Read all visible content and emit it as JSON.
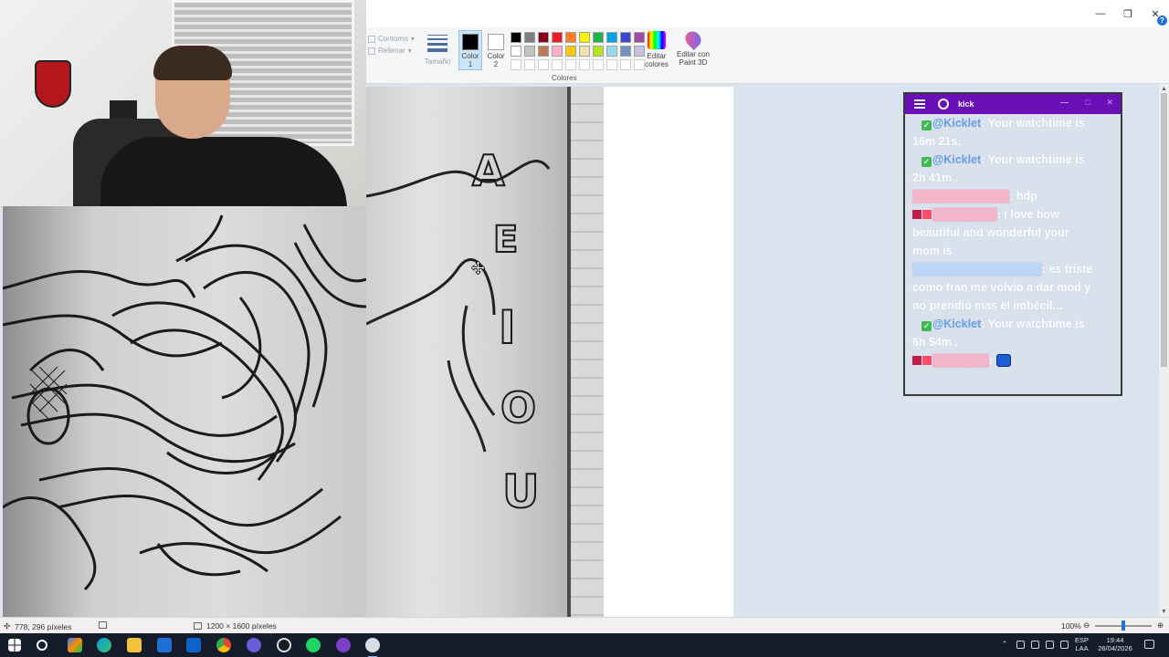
{
  "app": {
    "window_controls": {
      "minimize": "—",
      "restore": "❐",
      "close": "✕",
      "help": "?"
    }
  },
  "ribbon": {
    "outline_label": "Contorno",
    "fill_label": "Rellenar",
    "size_label": "Tamaño",
    "color1_label": [
      "Color",
      "1"
    ],
    "color2_label": [
      "Color",
      "2"
    ],
    "edit_colors_label": [
      "Editar",
      "colores"
    ],
    "edit_paint3d_label": [
      "Editar con",
      "Paint 3D"
    ],
    "colors_group_label": "Colores",
    "color1_value": "#000000",
    "color2_value": "#ffffff",
    "palette_row1": [
      "#000000",
      "#7f7f7f",
      "#880015",
      "#ed1c24",
      "#ff7f27",
      "#fff200",
      "#22b14c",
      "#00a2e8",
      "#3f48cc",
      "#a349a4"
    ],
    "palette_row2": [
      "#ffffff",
      "#c3c3c3",
      "#b97a57",
      "#ffaec9",
      "#ffc90e",
      "#efe4b0",
      "#b5e61d",
      "#99d9ea",
      "#7092be",
      "#c8bfe7"
    ],
    "palette_row3": [
      "#ffffff",
      "#ffffff",
      "#ffffff",
      "#ffffff",
      "#ffffff",
      "#ffffff",
      "#ffffff",
      "#ffffff",
      "#ffffff",
      "#ffffff"
    ]
  },
  "maze": {
    "letters": [
      "A",
      "E",
      "I",
      "O",
      "U"
    ]
  },
  "kick_chat": {
    "title": "kick",
    "controls": {
      "min": "—",
      "max": "□",
      "close": "✕"
    },
    "messages": [
      {
        "type": "bot",
        "user": "@Kicklet",
        "text": ": Your watchtime is",
        "cont": "16m 21s."
      },
      {
        "type": "bot",
        "user": "@Kicklet",
        "text": ": Your watchtime is",
        "cont": "2h 41m ."
      },
      {
        "type": "pink",
        "user": "████████████",
        "text": ": hdp"
      },
      {
        "type": "badge",
        "user": "████████",
        "text": ": i love how",
        "cont": "beautiful and wonderful your",
        "cont2": "mom is"
      },
      {
        "type": "lblue",
        "user": "████████████████",
        "text": ": es triste",
        "cont": "como fran me volvió a dar mod y",
        "cont2": "no prendió mas el imbécil..."
      },
      {
        "type": "bot",
        "user": "@Kicklet",
        "text": ": Your watchtime is",
        "cont": "6h 54m ."
      },
      {
        "type": "badge-emote",
        "user": "███████",
        "text": ":"
      }
    ]
  },
  "statusbar": {
    "cursor_position": "778, 296 píxeles",
    "image_size": "1200 × 1600 píxeles",
    "zoom": "100%",
    "zoom_fraction": 0.5
  },
  "taskbar": {
    "lang_top": "ESP",
    "lang_bottom": "LAA",
    "time": "19:44",
    "date": "26/04/2026"
  }
}
